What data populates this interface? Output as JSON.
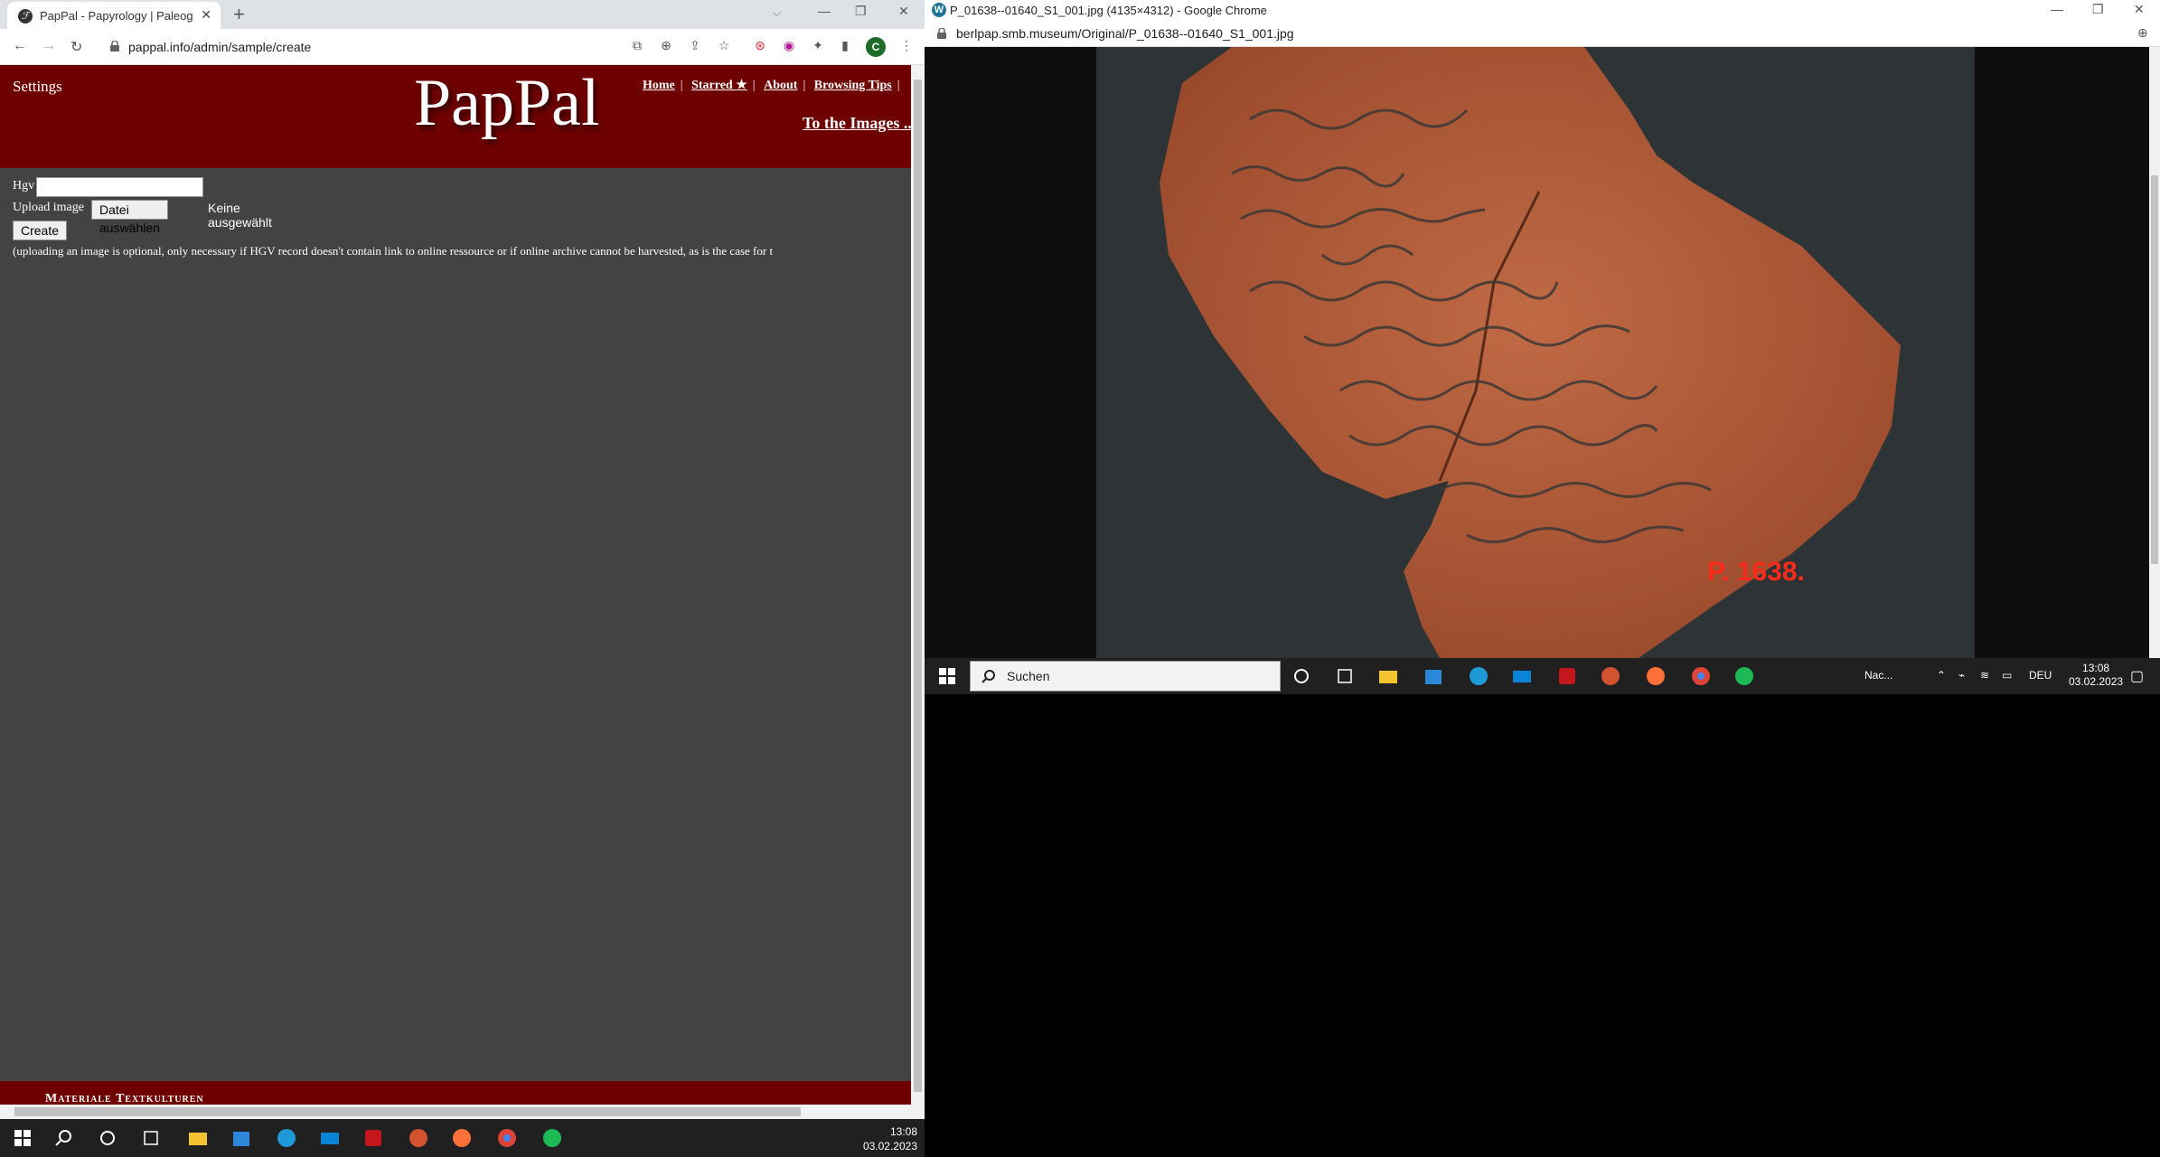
{
  "left_window": {
    "tab": {
      "title": "PapPal - Papyrology | Paleograph",
      "favicon": "ℱ"
    },
    "url": "pappal.info/admin/sample/create",
    "profile_initial": "C",
    "site": {
      "settings_label": "Settings",
      "logo": "PapPal",
      "nav": [
        {
          "label": "Home"
        },
        {
          "label": "Starred ★"
        },
        {
          "label": "About"
        },
        {
          "label": "Browsing Tips"
        }
      ],
      "to_images": "To the Images ..."
    },
    "form": {
      "hgv_label": "Hgv",
      "upload_label": "Upload image",
      "file_button": "Datei auswählen",
      "file_status": "Keine ausgewählt",
      "create_button": "Create",
      "note": "(uploading an image is optional, only necessary if HGV record doesn't contain link to online ressource or if online archive cannot be harvested, as is the case for t"
    },
    "footer_text": "Materiale Textkulturen",
    "clock": {
      "time": "13:08",
      "date": "03.02.2023"
    }
  },
  "right_window": {
    "title": "P_01638--01640_S1_001.jpg (4135×4312) - Google Chrome",
    "favicon": "W",
    "url": "berlpap.smb.museum/Original/P_01638--01640_S1_001.jpg",
    "ostracon_label": "P. 1638.",
    "taskbar": {
      "search_placeholder": "Suchen",
      "news": "Nac...",
      "lang": "DEU",
      "time": "13:08",
      "date": "03.02.2023"
    }
  },
  "colors": {
    "header_red": "#6e0000",
    "page_bg": "#434343",
    "taskbar": "#202020",
    "clay": "#b8603f"
  }
}
